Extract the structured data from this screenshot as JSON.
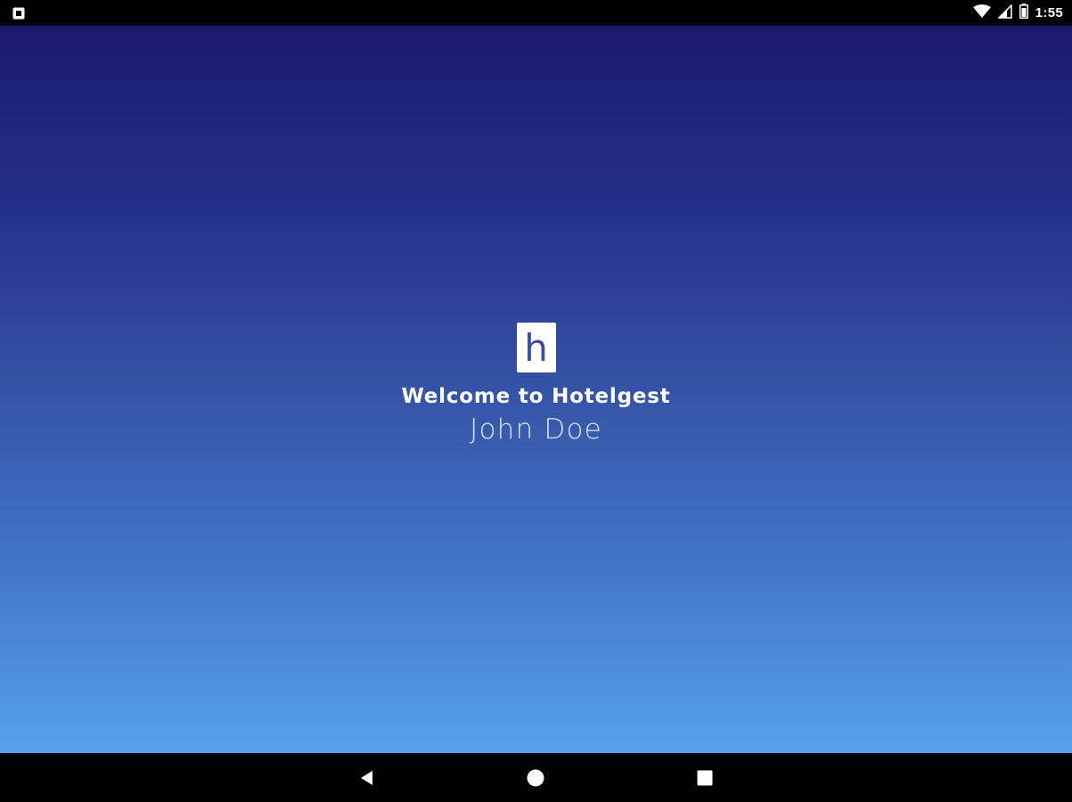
{
  "status_bar": {
    "time": "1:55",
    "icons": [
      "notification-icon",
      "wifi-icon",
      "cell-signal-icon",
      "battery-icon"
    ]
  },
  "splash": {
    "logo_letter": "h",
    "welcome_text": "Welcome to Hotelgest",
    "user_name": "John Doe"
  },
  "nav_bar": {
    "buttons": [
      "back-icon",
      "home-icon",
      "recents-icon"
    ]
  },
  "colors": {
    "gradient_top": "#1b1a6e",
    "gradient_bottom": "#56a2ec",
    "logo_letter": "#3a4d9e",
    "bars": "#000000"
  }
}
